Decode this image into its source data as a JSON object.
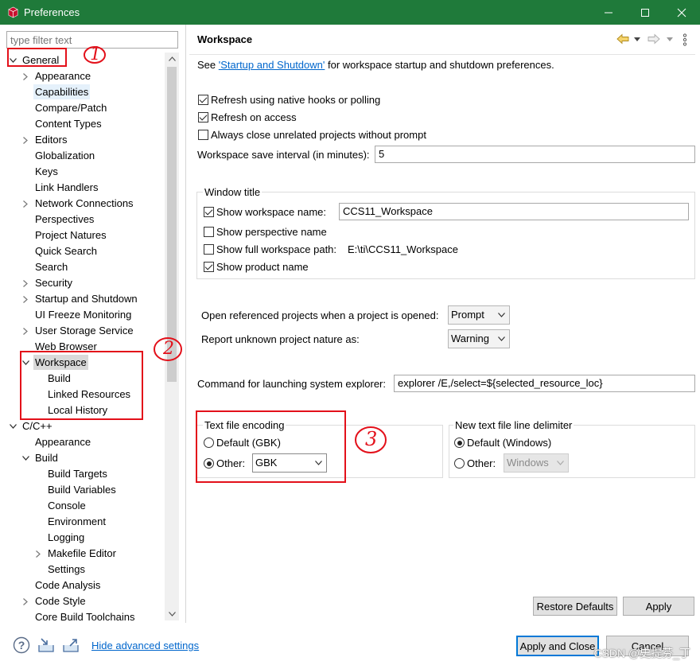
{
  "window": {
    "title": "Preferences",
    "controls": [
      "minimize-icon",
      "maximize-icon",
      "close-icon"
    ]
  },
  "sidebar": {
    "filter_placeholder": "type filter text",
    "tree": [
      {
        "label": "General",
        "level": 0,
        "expand": "open"
      },
      {
        "label": "Appearance",
        "level": 1,
        "expand": "closed"
      },
      {
        "label": "Capabilities",
        "level": 1,
        "expand": "none"
      },
      {
        "label": "Compare/Patch",
        "level": 1,
        "expand": "none"
      },
      {
        "label": "Content Types",
        "level": 1,
        "expand": "none"
      },
      {
        "label": "Editors",
        "level": 1,
        "expand": "closed"
      },
      {
        "label": "Globalization",
        "level": 1,
        "expand": "none"
      },
      {
        "label": "Keys",
        "level": 1,
        "expand": "none"
      },
      {
        "label": "Link Handlers",
        "level": 1,
        "expand": "none"
      },
      {
        "label": "Network Connections",
        "level": 1,
        "expand": "closed"
      },
      {
        "label": "Perspectives",
        "level": 1,
        "expand": "none"
      },
      {
        "label": "Project Natures",
        "level": 1,
        "expand": "none"
      },
      {
        "label": "Quick Search",
        "level": 1,
        "expand": "none"
      },
      {
        "label": "Search",
        "level": 1,
        "expand": "none"
      },
      {
        "label": "Security",
        "level": 1,
        "expand": "closed"
      },
      {
        "label": "Startup and Shutdown",
        "level": 1,
        "expand": "closed"
      },
      {
        "label": "UI Freeze Monitoring",
        "level": 1,
        "expand": "none"
      },
      {
        "label": "User Storage Service",
        "level": 1,
        "expand": "closed"
      },
      {
        "label": "Web Browser",
        "level": 1,
        "expand": "none"
      },
      {
        "label": "Workspace",
        "level": 1,
        "expand": "open",
        "selected": true
      },
      {
        "label": "Build",
        "level": 2,
        "expand": "none"
      },
      {
        "label": "Linked Resources",
        "level": 2,
        "expand": "none"
      },
      {
        "label": "Local History",
        "level": 2,
        "expand": "none"
      },
      {
        "label": "C/C++",
        "level": 0,
        "expand": "open"
      },
      {
        "label": "Appearance",
        "level": 1,
        "expand": "none"
      },
      {
        "label": "Build",
        "level": 1,
        "expand": "open"
      },
      {
        "label": "Build Targets",
        "level": 2,
        "expand": "none"
      },
      {
        "label": "Build Variables",
        "level": 2,
        "expand": "none"
      },
      {
        "label": "Console",
        "level": 2,
        "expand": "none"
      },
      {
        "label": "Environment",
        "level": 2,
        "expand": "none"
      },
      {
        "label": "Logging",
        "level": 2,
        "expand": "none"
      },
      {
        "label": "Makefile Editor",
        "level": 2,
        "expand": "closed"
      },
      {
        "label": "Settings",
        "level": 2,
        "expand": "none"
      },
      {
        "label": "Code Analysis",
        "level": 1,
        "expand": "none"
      },
      {
        "label": "Code Style",
        "level": 1,
        "expand": "closed"
      },
      {
        "label": "Core Build Toolchains",
        "level": 1,
        "expand": "none"
      }
    ]
  },
  "page": {
    "title": "Workspace",
    "intro_prefix": "See ",
    "intro_link": "'Startup and Shutdown'",
    "intro_suffix": " for workspace startup and shutdown preferences.",
    "refresh_native": {
      "label": "Refresh using native hooks or polling",
      "checked": true
    },
    "refresh_access": {
      "label": "Refresh on access",
      "checked": true
    },
    "always_close": {
      "label": "Always close unrelated projects without prompt",
      "checked": false
    },
    "save_interval": {
      "label": "Workspace save interval (in minutes):",
      "value": "5"
    },
    "window_title": {
      "group_label": "Window title",
      "show_workspace_name": {
        "label": "Show workspace name:",
        "checked": true,
        "value": "CCS11_Workspace"
      },
      "show_perspective_name": {
        "label": "Show perspective name",
        "checked": false
      },
      "show_full_path": {
        "label": "Show full workspace path:",
        "checked": false,
        "value": "E:\\ti\\CCS11_Workspace"
      },
      "show_product_name": {
        "label": "Show product name",
        "checked": true
      }
    },
    "open_referenced": {
      "label": "Open referenced projects when a project is opened:",
      "value": "Prompt"
    },
    "report_unknown": {
      "label": "Report unknown project nature as:",
      "value": "Warning"
    },
    "explorer_command": {
      "label": "Command for launching system explorer:",
      "value": "explorer /E,/select=${selected_resource_loc}"
    },
    "text_encoding": {
      "group_label": "Text file encoding",
      "default_option": "Default (GBK)",
      "other_option": "Other:",
      "other_value": "GBK",
      "selected": "other"
    },
    "line_delimiter": {
      "group_label": "New text file line delimiter",
      "default_option": "Default (Windows)",
      "other_option": "Other:",
      "other_value": "Windows",
      "selected": "default"
    },
    "restore_defaults_label": "Restore Defaults",
    "apply_label": "Apply"
  },
  "footer": {
    "hide_advanced_link": "Hide advanced settings",
    "apply_close_label": "Apply and Close",
    "cancel_label": "Cancel",
    "icons": [
      "help-icon",
      "import-icon",
      "export-icon"
    ]
  },
  "annotations": [
    "1",
    "2",
    "3"
  ],
  "watermark": "CSDN @史提芬_丁",
  "colors": {
    "titlebar": "#1f7a3a",
    "link": "#0066cc",
    "annotation_red": "#e3101a",
    "primary_border": "#0078d7"
  }
}
